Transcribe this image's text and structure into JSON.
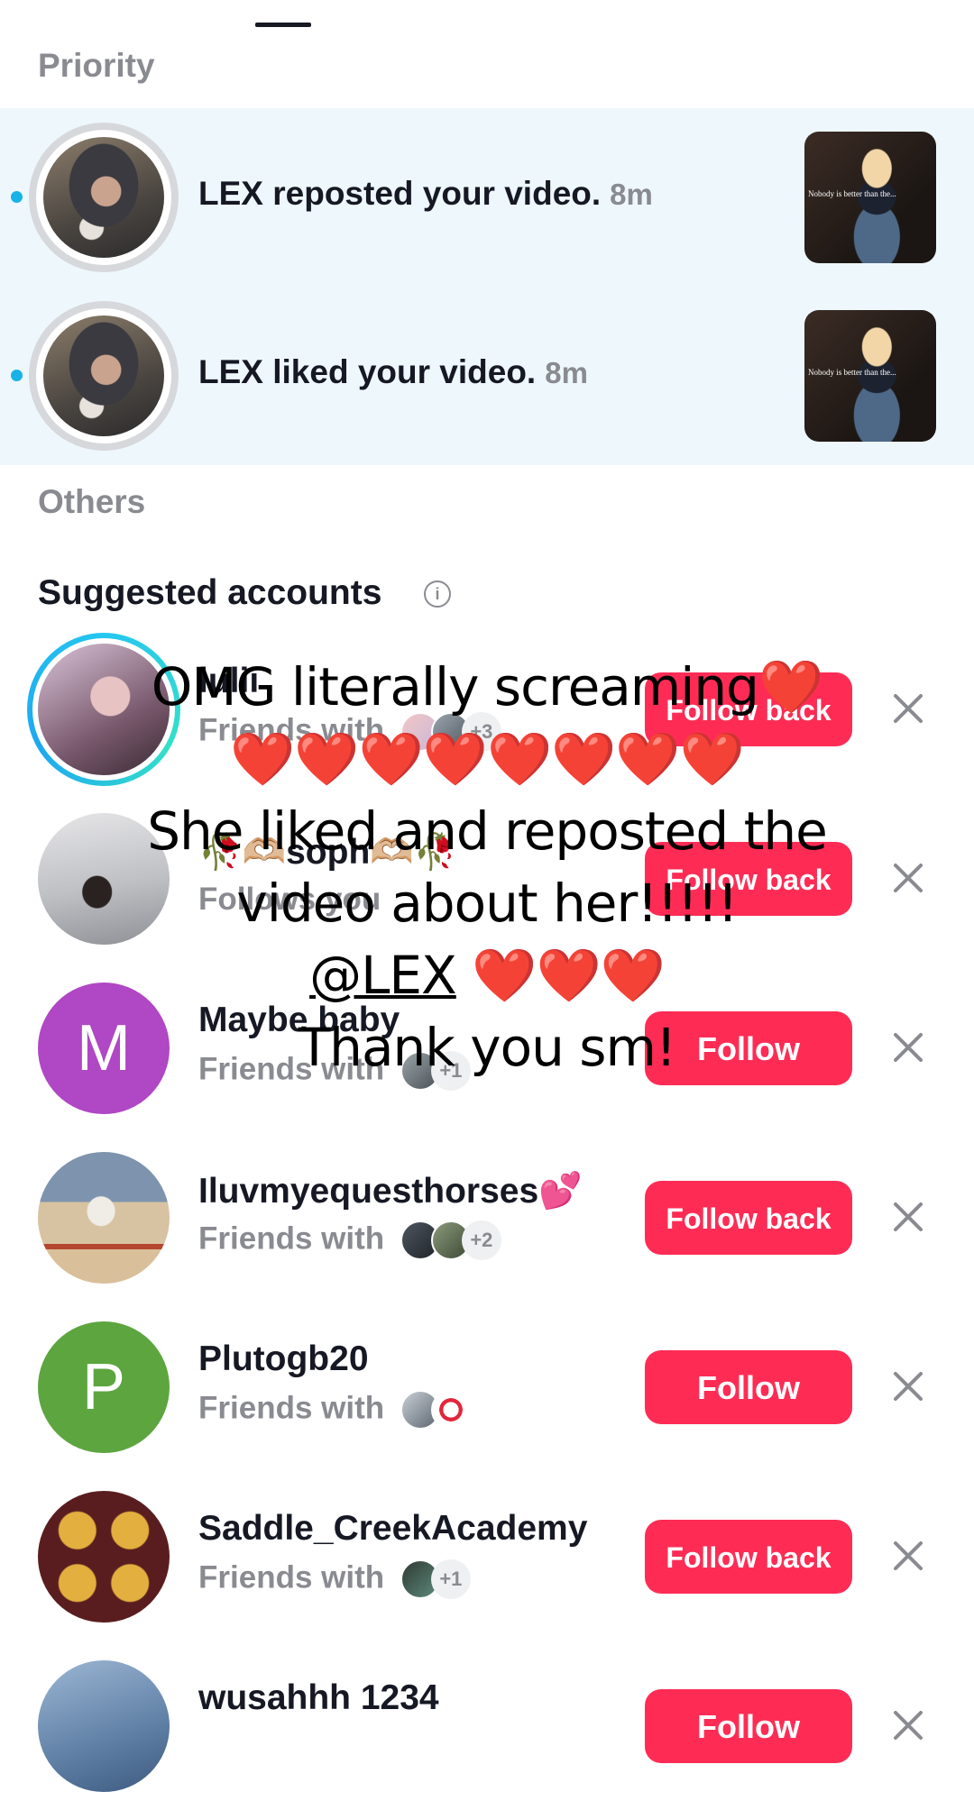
{
  "priority": {
    "title": "Priority",
    "items": [
      {
        "text": "LEX reposted your video.",
        "time": "8m",
        "thumb_caption": "Nobody is better than the..."
      },
      {
        "text": "LEX liked your video.",
        "time": "8m",
        "thumb_caption": "Nobody is better than the..."
      }
    ]
  },
  "others": {
    "title": "Others"
  },
  "suggested": {
    "title": "Suggested accounts",
    "info_icon": "i",
    "items": [
      {
        "name": "lulii",
        "sub": "Friends with",
        "count": "+3",
        "button": "Follow back"
      },
      {
        "name": "🥀🫶🏼soph🫶🏼🥀",
        "sub": "Follows you",
        "button": "Follow back"
      },
      {
        "name": "Maybe baby",
        "sub": "Friends with",
        "count": "+1",
        "button": "Follow",
        "letter": "M",
        "avatar_color": "#b047c4"
      },
      {
        "name": "Iluvmyequesthorses💕",
        "sub": "Friends with",
        "count": "+2",
        "button": "Follow back"
      },
      {
        "name": "Plutogb20",
        "sub": "Friends with",
        "button": "Follow",
        "letter": "P",
        "avatar_color": "#5da53f"
      },
      {
        "name": "Saddle_CreekAcademy",
        "sub": "Friends with",
        "count": "+1",
        "button": "Follow back"
      },
      {
        "name": "wusahhh 1234",
        "button": "Follow"
      }
    ]
  },
  "overlay": {
    "line1": "OMG literally screaming❤️",
    "line2": "❤️❤️❤️❤️❤️❤️❤️❤️",
    "line3": "She liked and reposted the",
    "line4": "video about her!!!!!",
    "mention": "@LEX",
    "hearts": "❤️❤️❤️",
    "line6": "Thank you sm!"
  },
  "colors": {
    "accent": "#fe2c55",
    "unread_dot": "#19b2e8",
    "priority_bg": "#eef8fc",
    "muted": "#8a8b91"
  }
}
